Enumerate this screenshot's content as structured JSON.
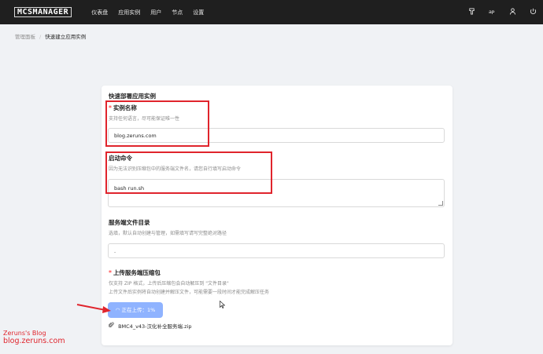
{
  "brand": {
    "logo": "MCSMANAGER"
  },
  "nav": {
    "items": [
      "仪表盘",
      "应用实例",
      "用户",
      "节点",
      "设置"
    ]
  },
  "top_icons": [
    "theme-icon",
    "translate-icon",
    "user-icon",
    "logout-icon"
  ],
  "breadcrumb": {
    "root": "管理面板",
    "separator": "/",
    "current": "快速建立应用实例"
  },
  "form": {
    "title": "快速部署应用实例",
    "instance_name": {
      "required_mark": "*",
      "label": "实例名称",
      "help": "支持任何语言，尽可能保证唯一性",
      "value": "blog.zeruns.com"
    },
    "start_command": {
      "label": "启动命令",
      "help": "因为无法识别压缩包中的服务端文件名，请您自行填写启动命令",
      "value": "bash run.sh"
    },
    "server_dir": {
      "label": "服务端文件目录",
      "help": "选填，默认自动创建与管理，如需填写请写完整绝对路径",
      "value": "."
    },
    "upload": {
      "required_mark": "*",
      "label": "上传服务端压缩包",
      "help_line1": "仅支持 ZIP 格式，上传后压缩包会自动解压到 \"文件目录\"",
      "help_line2": "上传文件后实例将自动创建并解压文件，可能需要一段时间才能完成解压任务",
      "button_text": "正在上传：1%",
      "progress_percent": 1,
      "file_name": "BMC4_v43-汉化补全服务端.zip"
    }
  },
  "watermark": {
    "line1": "Zeruns's Blog",
    "line2": "blog.zeruns.com"
  },
  "colors": {
    "topbar": "#1f1f1f",
    "highlight": "#e0242c",
    "upload_button": "#8fb3ff",
    "page_bg": "#f0f2f5"
  }
}
